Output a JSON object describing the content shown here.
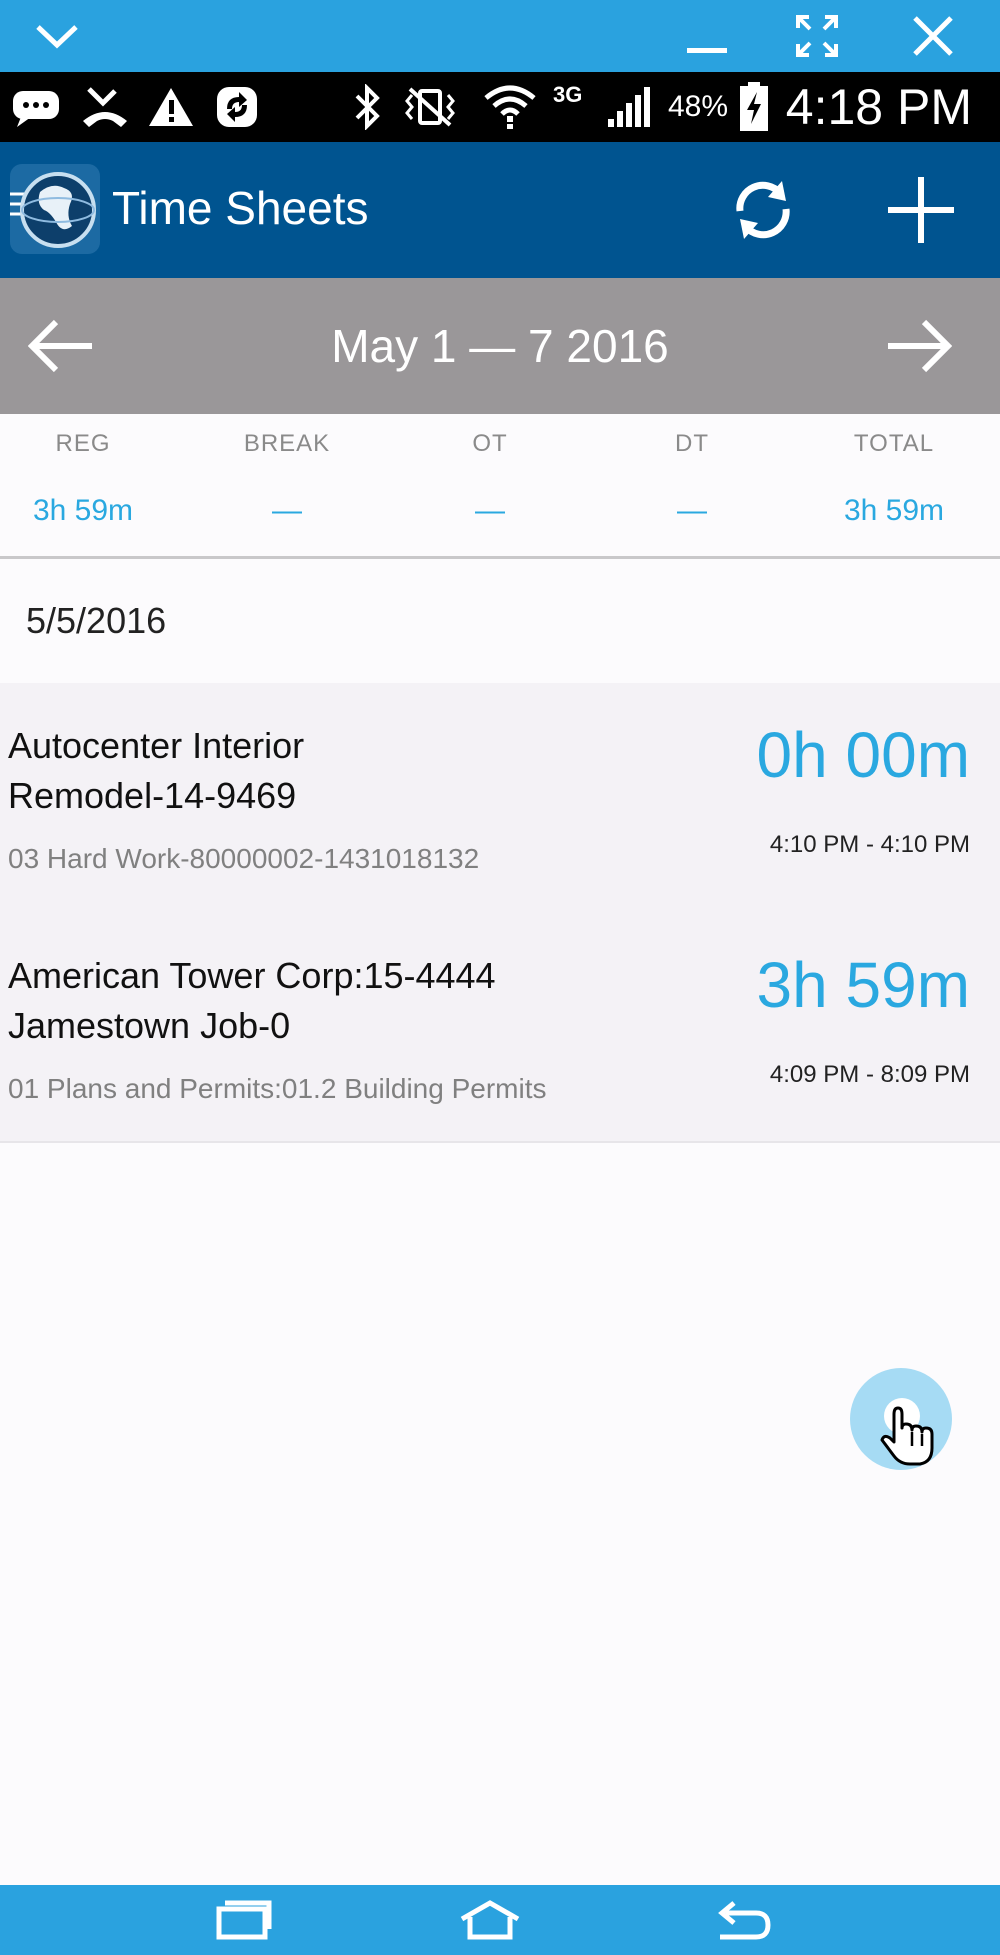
{
  "window_bar": {
    "icons": [
      "chevron-down-icon",
      "minimize-icon",
      "fullscreen-icon",
      "close-icon"
    ]
  },
  "status_bar": {
    "icons": [
      "message-icon",
      "missed-call-icon",
      "warning-icon",
      "sync-app-icon",
      "bluetooth-icon",
      "vibrate-icon",
      "wifi-icon",
      "signal-icon",
      "battery-charging-icon"
    ],
    "network": "3G",
    "battery": "48%",
    "time": "4:18 PM"
  },
  "app_bar": {
    "title": "Time Sheets",
    "icons": [
      "app-logo-globe-icon",
      "refresh-icon",
      "plus-icon"
    ]
  },
  "range": {
    "label": "May 1 — 7 2016",
    "icons": [
      "arrow-left-icon",
      "arrow-right-icon"
    ]
  },
  "totals": [
    {
      "label": "REG",
      "value": "3h 59m"
    },
    {
      "label": "BREAK",
      "value": "—"
    },
    {
      "label": "OT",
      "value": "—"
    },
    {
      "label": "DT",
      "value": "—"
    },
    {
      "label": "TOTAL",
      "value": "3h 59m"
    }
  ],
  "date_header": "5/5/2016",
  "entries": [
    {
      "title_line1": "Autocenter Interior",
      "title_line2": "Remodel-14-9469",
      "subtitle": "03 Hard Work-80000002-1431018132",
      "duration": "0h 00m",
      "times": "4:10 PM  -  4:10 PM"
    },
    {
      "title_line1": "American Tower Corp:15-4444",
      "title_line2": "Jamestown Job-0",
      "subtitle": "01 Plans and Permits:01.2 Building Permits",
      "duration": "3h 59m",
      "times": "4:09 PM  -  8:09 PM"
    }
  ],
  "nav_bar": {
    "icons": [
      "recent-apps-icon",
      "home-icon",
      "back-icon"
    ]
  },
  "colors": {
    "window_bar": "#2aa2df",
    "app_bar": "#005490",
    "range_bar": "#9a9799",
    "accent": "#2aa8e0"
  }
}
